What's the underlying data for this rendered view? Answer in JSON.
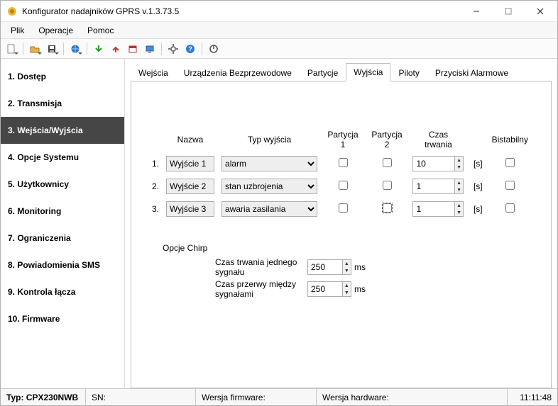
{
  "window": {
    "title": "Konfigurator nadajników GPRS v.1.3.73.5"
  },
  "menubar": {
    "items": [
      "Plik",
      "Operacje",
      "Pomoc"
    ]
  },
  "sidebar": {
    "items": [
      "1. Dostęp",
      "2. Transmisja",
      "3. Wejścia/Wyjścia",
      "4. Opcje Systemu",
      "5. Użytkownicy",
      "6. Monitoring",
      "7. Ograniczenia",
      "8. Powiadomienia SMS",
      "9. Kontrola łącza",
      "10. Firmware"
    ],
    "active_index": 2
  },
  "tabs": {
    "items": [
      "Wejścia",
      "Urządzenia Bezprzewodowe",
      "Partycje",
      "Wyjścia",
      "Piloty",
      "Przyciski Alarmowe"
    ],
    "active_index": 3
  },
  "outputs": {
    "headers": {
      "name": "Nazwa",
      "type": "Typ wyjścia",
      "part1": "Partycja 1",
      "part2": "Partycja 2",
      "duration": "Czas trwania",
      "bistable": "Bistabilny"
    },
    "unit": "[s]",
    "rows": [
      {
        "idx": "1.",
        "name": "Wyjście 1",
        "type": "alarm",
        "p1": false,
        "p2": false,
        "duration": "10",
        "bi": false
      },
      {
        "idx": "2.",
        "name": "Wyjście 2",
        "type": "stan uzbrojenia",
        "p1": false,
        "p2": false,
        "duration": "1",
        "bi": false
      },
      {
        "idx": "3.",
        "name": "Wyjście 3",
        "type": "awaria zasilania",
        "p1": false,
        "p2": false,
        "duration": "1",
        "bi": false
      }
    ]
  },
  "chirp": {
    "title": "Opcje Chirp",
    "label_signal": "Czas trwania jednego sygnału",
    "label_gap": "Czas przerwy między sygnałami",
    "signal_value": "250",
    "gap_value": "250",
    "unit": "ms"
  },
  "statusbar": {
    "type_label": "Typ:",
    "type_value": "CPX230NWB",
    "sn_label": "SN:",
    "fw_label": "Wersja firmware:",
    "hw_label": "Wersja hardware:",
    "clock": "11:11:48"
  }
}
